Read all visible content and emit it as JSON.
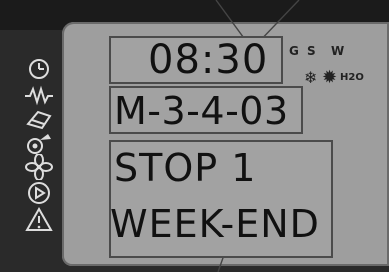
{
  "display": {
    "time": "08:30",
    "program": "M-3-4-03",
    "status_line1": "STOP 1",
    "status_line2": "WEEK-END"
  },
  "season_flags": {
    "g": "G",
    "s": "S",
    "w": "W"
  },
  "mode_indicators": {
    "h2o_label": "H2O",
    "icons": [
      "snowflake-icon",
      "sun-icon"
    ]
  },
  "side_icons": [
    "clock-icon",
    "zigzag-wave-icon",
    "valve-icon",
    "pump-icon",
    "fan-icon",
    "play-circle-icon",
    "warning-icon"
  ],
  "colors": {
    "screen_bg": "#9e9e9e",
    "bezel": "#2a2a2a",
    "text": "#111111"
  }
}
